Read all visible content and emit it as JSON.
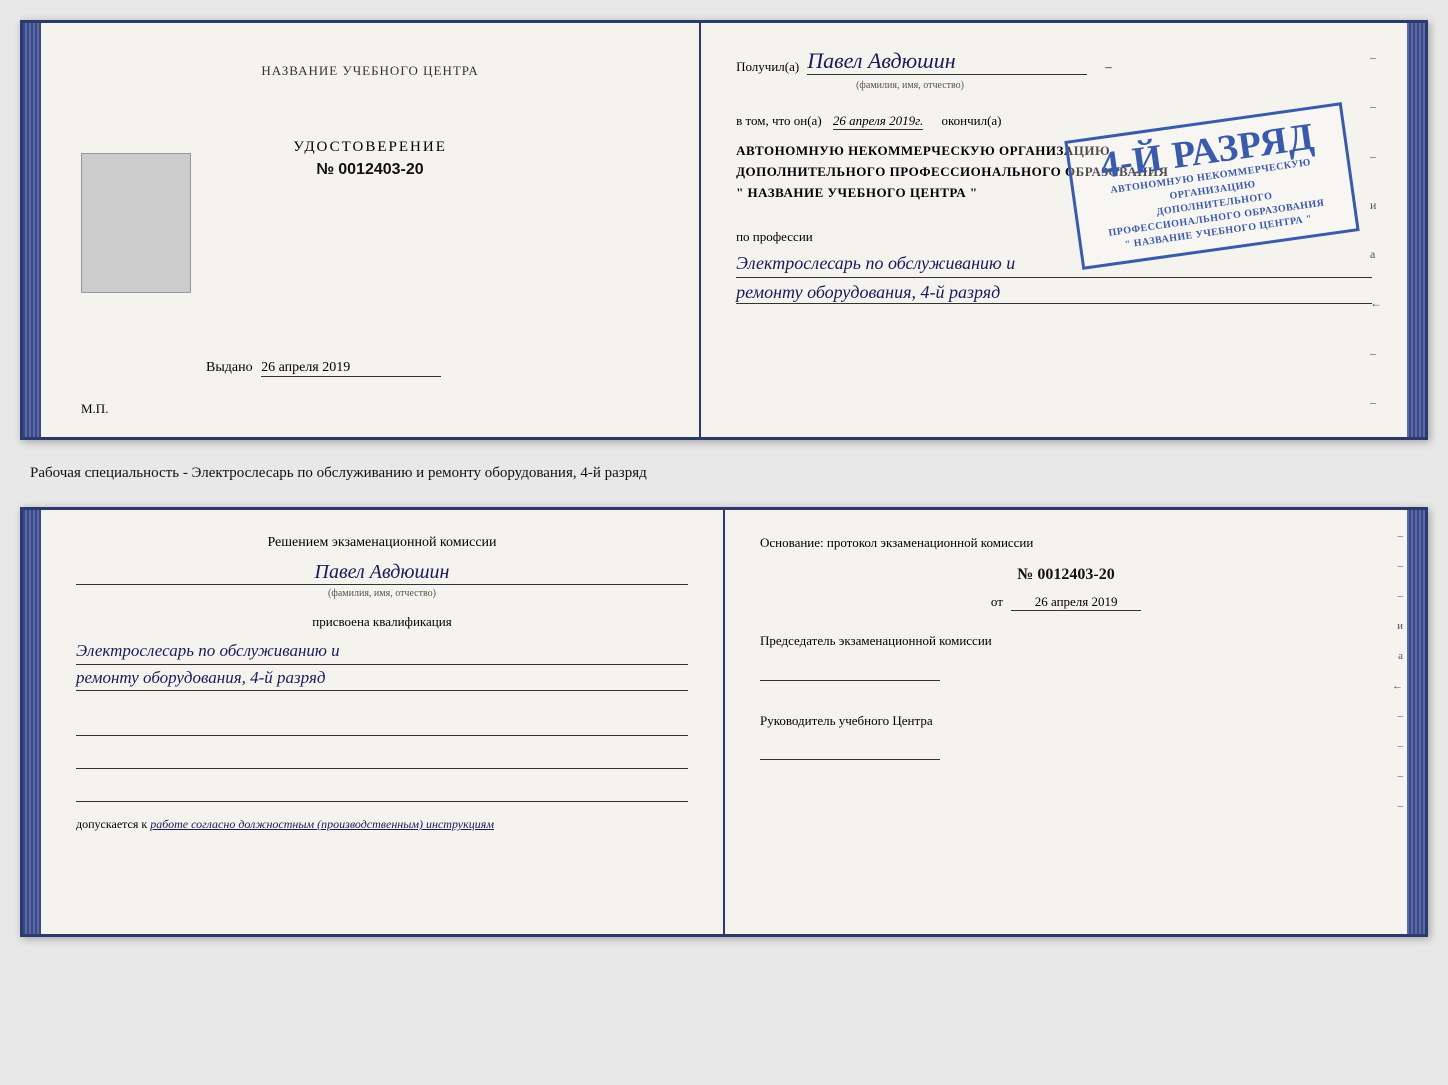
{
  "top_document": {
    "left_page": {
      "title": "НАЗВАНИЕ УЧЕБНОГО ЦЕНТРА",
      "cert_type": "УДОСТОВЕРЕНИЕ",
      "cert_number_prefix": "№",
      "cert_number": "0012403-20",
      "issued_label": "Выдано",
      "issued_date": "26 апреля 2019",
      "mp_label": "М.П."
    },
    "right_page": {
      "received_label": "Получил(а)",
      "recipient_name": "Павел Авдюшин",
      "fio_hint": "(фамилия, имя, отчество)",
      "dash": "–",
      "in_that_label": "в том, что он(а)",
      "completion_date": "26 апреля 2019г.",
      "finished_label": "окончил(а)",
      "stamp_line1": "4-й разряд",
      "org_line1": "АВТОНОМНУЮ НЕКОММЕРЧЕСКУЮ ОРГАНИЗАЦИЮ",
      "org_line2": "ДОПОЛНИТЕЛЬНОГО ПРОФЕССИОНАЛЬНОГО ОБРАЗОВАНИЯ",
      "org_name": "\" НАЗВАНИЕ УЧЕБНОГО ЦЕНТРА \"",
      "profession_label": "по профессии",
      "profession_line1": "Электрослесарь по обслуживанию и",
      "profession_line2": "ремонту оборудования, 4-й разряд"
    }
  },
  "separator": {
    "text": "Рабочая специальность - Электрослесарь по обслуживанию и ремонту оборудования, 4-й разряд"
  },
  "bottom_document": {
    "left_page": {
      "commission_title": "Решением экзаменационной комиссии",
      "person_name": "Павел Авдюшин",
      "fio_hint": "(фамилия, имя, отчество)",
      "qualification_label": "присвоена квалификация",
      "qualification_line1": "Электрослесарь по обслуживанию и",
      "qualification_line2": "ремонту оборудования, 4-й разряд",
      "допускается_label": "допускается к",
      "допускается_text": "работе согласно должностным (производственным) инструкциям"
    },
    "right_page": {
      "osnov_label": "Основание: протокол экзаменационной комиссии",
      "protocol_prefix": "№",
      "protocol_number": "0012403-20",
      "date_prefix": "от",
      "protocol_date": "26 апреля 2019",
      "chairman_label": "Председатель экзаменационной комиссии",
      "director_label": "Руководитель учебного Центра"
    }
  },
  "right_side_marks": {
    "mark1": "–",
    "mark2": "–",
    "mark3": "–",
    "mark4": "и",
    "mark5": "а",
    "mark6": "←",
    "mark7": "–",
    "mark8": "–",
    "mark9": "–",
    "mark10": "–"
  }
}
